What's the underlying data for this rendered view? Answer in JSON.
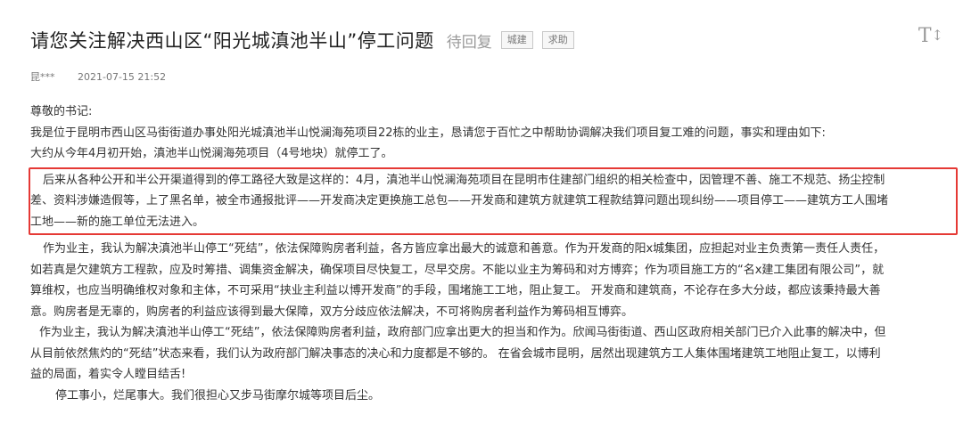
{
  "post": {
    "title": "请您关注解决西山区“阳光城滇池半山”停工问题",
    "status": "待回复",
    "tags": [
      "城建",
      "求助"
    ],
    "font_toggle": "T",
    "author": "昆***",
    "date": "2021-07-15 21:52"
  },
  "body": {
    "salutation": "尊敬的书记:",
    "p1": "我是位于昆明市西山区马街街道办事处阳光城滇池半山悦澜海苑项目22栋的业主，恳请您于百忙之中帮助协调解决我们项目复工难的问题，事实和理由如下:",
    "p2": "大约从今年4月初开始，滇池半山悦澜海苑项目（4号地块）就停工了。",
    "highlight_line1": "后来从各种公开和半公开渠道得到的停工路径大致是这样的：4月，滇池半山悦澜海苑项目在昆明市住建部门组织的相关检查中，因管理不善、施工不规范、扬尘控制",
    "highlight_line2": "差、资料涉嫌造假等，上了黑名单，被全市通报批评——开发商决定更换施工总包——开发商和建筑方就建筑工程款结算问题出现纠纷——项目停工——建筑方工人围堵",
    "highlight_line3": "工地——新的施工单位无法进入。",
    "p4_line1": "作为业主，我认为解决滇池半山停工“死结”，依法保障购房者利益，各方皆应拿出最大的诚意和善意。作为开发商的阳x城集团，应担起对业主负责第一责任人责任，",
    "p4_line2": "如若真是欠建筑方工程款，应及时筹措、调集资金解决，确保项目尽快复工，尽早交房。不能以业主为筹码和对方博弈；作为项目施工方的“名x建工集团有限公司”，就",
    "p4_line3": "算维权，也应当明确维权对象和主体，不可采用“挟业主利益以博开发商”的手段，围堵施工工地，阻止复工。 开发商和建筑商，不论存在多大分歧，都应该秉持最大善",
    "p4_line4": "意。购房者是无辜的，购房者的利益应该得到最大保障，双方分歧应依法解决，不可将购房者利益作为筹码相互博弈。",
    "p5_line1": "作为业主，我认为解决滇池半山停工“死结”，依法保障购房者利益，政府部门应拿出更大的担当和作为。欣闻马街街道、西山区政府相关部门已介入此事的解决中，但",
    "p5_line2": "从目前依然焦灼的“死结”状态来看，我们认为政府部门解决事态的决心和力度都是不够的。 在省会城市昆明，居然出现建筑方工人集体围堵建筑工地阻止复工，以博利",
    "p5_line3": "益的局面，着实令人瞠目结舌!",
    "p6": "停工事小，烂尾事大。我们很担心又步马街摩尔城等项目后尘。"
  },
  "colors": {
    "highlight_border": "#e53935",
    "status_text": "#999999"
  }
}
